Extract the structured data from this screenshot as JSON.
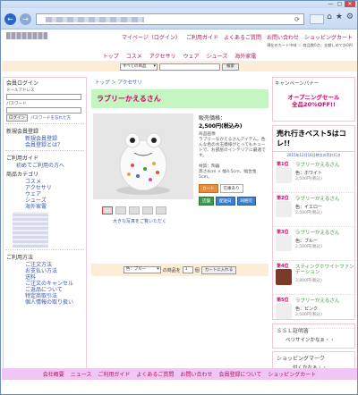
{
  "browser": {
    "back_icon": "arrow-left-icon",
    "forward_icon": "arrow-right-icon",
    "toolbar_icons": [
      "⌂",
      "★",
      "⚙"
    ],
    "window_buttons": [
      "—",
      "▢",
      "✕"
    ]
  },
  "header": {
    "toplinks": [
      "マイページ（ログイン）",
      "ご利用ガイド",
      "よくあるご質問",
      "お問い合わせ",
      "ショッピングカート"
    ],
    "cart_info": "現在のカート中味 ＝ 商品数0点、金額しめて計0円"
  },
  "nav": [
    "トップ",
    "コスメ",
    "アクセサリ",
    "ウェア",
    "シューズ",
    "海外家電"
  ],
  "search": {
    "category": "すべての商品",
    "button": "検索"
  },
  "left": {
    "login_title": "会員ログイン",
    "email_label": "メールアドレス",
    "password_label": "パスワード",
    "login_button": "ログイン",
    "forgot_label": "パスワードを忘れた方",
    "register_title": "新規会員登録",
    "register_links": [
      "新規会員登録",
      "会員登録とは？"
    ],
    "guide_title": "ご利用ガイド",
    "guide_first": "初めてご利用の方へ",
    "category_title": "商品カテゴリ",
    "categories": [
      "コスメ",
      "アクセサリ",
      "ウェア",
      "シューズ",
      "海外家電"
    ],
    "howto_title": "ご利用方法",
    "howto": [
      "ご注文方法",
      "お支払い方法",
      "送料",
      "ご注文のキャンセル",
      "ご返品について",
      "特定商取引法",
      "個人情報の取り扱い"
    ]
  },
  "product": {
    "breadcrumb_home": "トップ",
    "breadcrumb_sep": "＞",
    "breadcrumb_cat": "アクセサリ",
    "title": "ラブリーかえるさん",
    "price_label": "販売価格：",
    "price": "2,500円(税込み)",
    "desc": "商品画像\nラブリーなかえるさんアイテム。色んな色の水玉模様がとってもキュートで、お部屋のインテリアに最適です。\n\n材質：陶器\n高さ4cm × 幅4.5cm、幅合金5cm。",
    "tags": [
      "カート",
      "在庫あり",
      "店舗",
      "配送日",
      "同梱可"
    ],
    "zoom_link": "大きな写真をご覧いただく",
    "variant": "色：ブルー",
    "qty_label": "の商品を",
    "qty": "1",
    "qty_unit": "個",
    "add_to_cart": "カートに入れる"
  },
  "right": {
    "banner_title": "キャンペーンバナー",
    "banner_text": "オープニングセール\n全品20%OFF!!",
    "rank_title": "売れ行きベスト5はコレ!!",
    "rank_date": "2015年12月16日時点の売れ行き",
    "ranks": [
      {
        "no": "第1位",
        "name": "ラブリーかえるさん",
        "color": "色：ホワイト",
        "price": "2,500円(税込)"
      },
      {
        "no": "第2位",
        "name": "ラブリーかえるさん",
        "color": "色：イエロー",
        "price": "2,500円(税込)"
      },
      {
        "no": "第3位",
        "name": "ラブリーかえるさん",
        "color": "色：ブルー",
        "price": "2,500円(税込)"
      },
      {
        "no": "第4位",
        "name": "スティングホワイトファンデーション",
        "color": "",
        "price": "3,800円(税込)"
      },
      {
        "no": "第5位",
        "name": "ラブリーかえるさん",
        "color": "色：ピンク",
        "price": "2,500円(税込)"
      }
    ],
    "ssl_title": "ＳＳＬ証明書",
    "ssl_text": "ベリサインかなぁ・・",
    "shopmark_title": "ショッピングマーク",
    "shopmark_text": "付くかなぁ・・"
  },
  "footer": [
    "会社概要",
    "ニュース",
    "ご利用ガイド",
    "よくあるご質問",
    "お問い合わせ",
    "会員登録について",
    "ショッピングカート"
  ],
  "colors": {
    "accent": "#d0006c",
    "title_bg": "#c5f5c0",
    "footer_bg": "#f0c6f4",
    "search_bg": "#fdecd6"
  }
}
